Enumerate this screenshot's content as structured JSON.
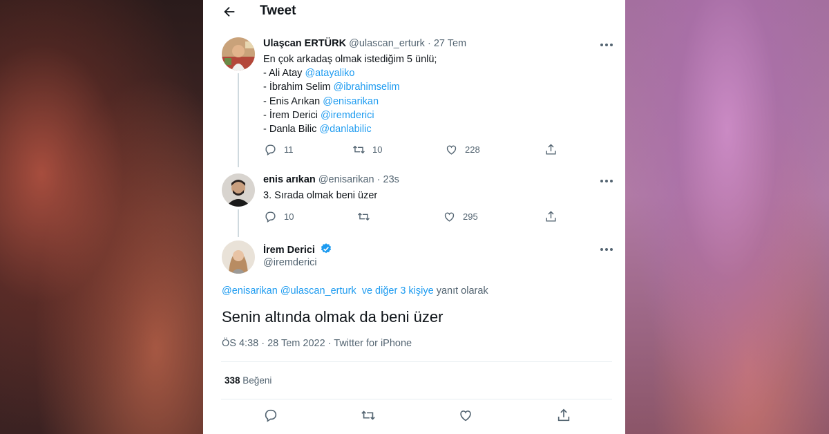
{
  "header": {
    "title": "Tweet"
  },
  "tweets": [
    {
      "name": "Ulaşcan ERTÜRK",
      "handle": "@ulascan_erturk",
      "sep": "·",
      "time": "27 Tem",
      "lines": [
        {
          "text": "En çok arkadaş olmak istediğim 5 ünlü;",
          "mention": ""
        },
        {
          "text": "- Ali Atay ",
          "mention": "@atayaliko"
        },
        {
          "text": "- İbrahim Selim ",
          "mention": "@ibrahimselim"
        },
        {
          "text": "- Enis Arıkan ",
          "mention": "@enisarikan"
        },
        {
          "text": "- İrem Derici ",
          "mention": "@iremderici"
        },
        {
          "text": "- Danla Bilic ",
          "mention": "@danlabilic"
        }
      ],
      "replies": "11",
      "retweets": "10",
      "likes": "228"
    },
    {
      "name": "enis arıkan",
      "handle": "@enisarikan",
      "sep": "·",
      "time": "23s",
      "text": "3. Sırada olmak beni üzer",
      "replies": "10",
      "retweets": "",
      "likes": "295"
    }
  ],
  "main": {
    "name": "İrem Derici",
    "handle": "@iremderici",
    "reply_mentions": "@enisarikan @ulascan_erturk",
    "reply_others": "ve diğer 3 kişiye",
    "reply_suffix": "yanıt olarak",
    "text": "Senin altında olmak da beni üzer",
    "meta": "ÖS 4:38 · 28 Tem 2022 · Twitter for iPhone",
    "like_count": "338",
    "like_label": "Beğeni"
  },
  "colors": {
    "accent": "#1d9bf0",
    "text": "#0f1419",
    "muted": "#536471",
    "border": "#e6ecf0"
  },
  "icons": [
    "back-arrow-icon",
    "more-icon",
    "reply-icon",
    "retweet-icon",
    "like-icon",
    "share-icon",
    "verified-badge-icon"
  ]
}
